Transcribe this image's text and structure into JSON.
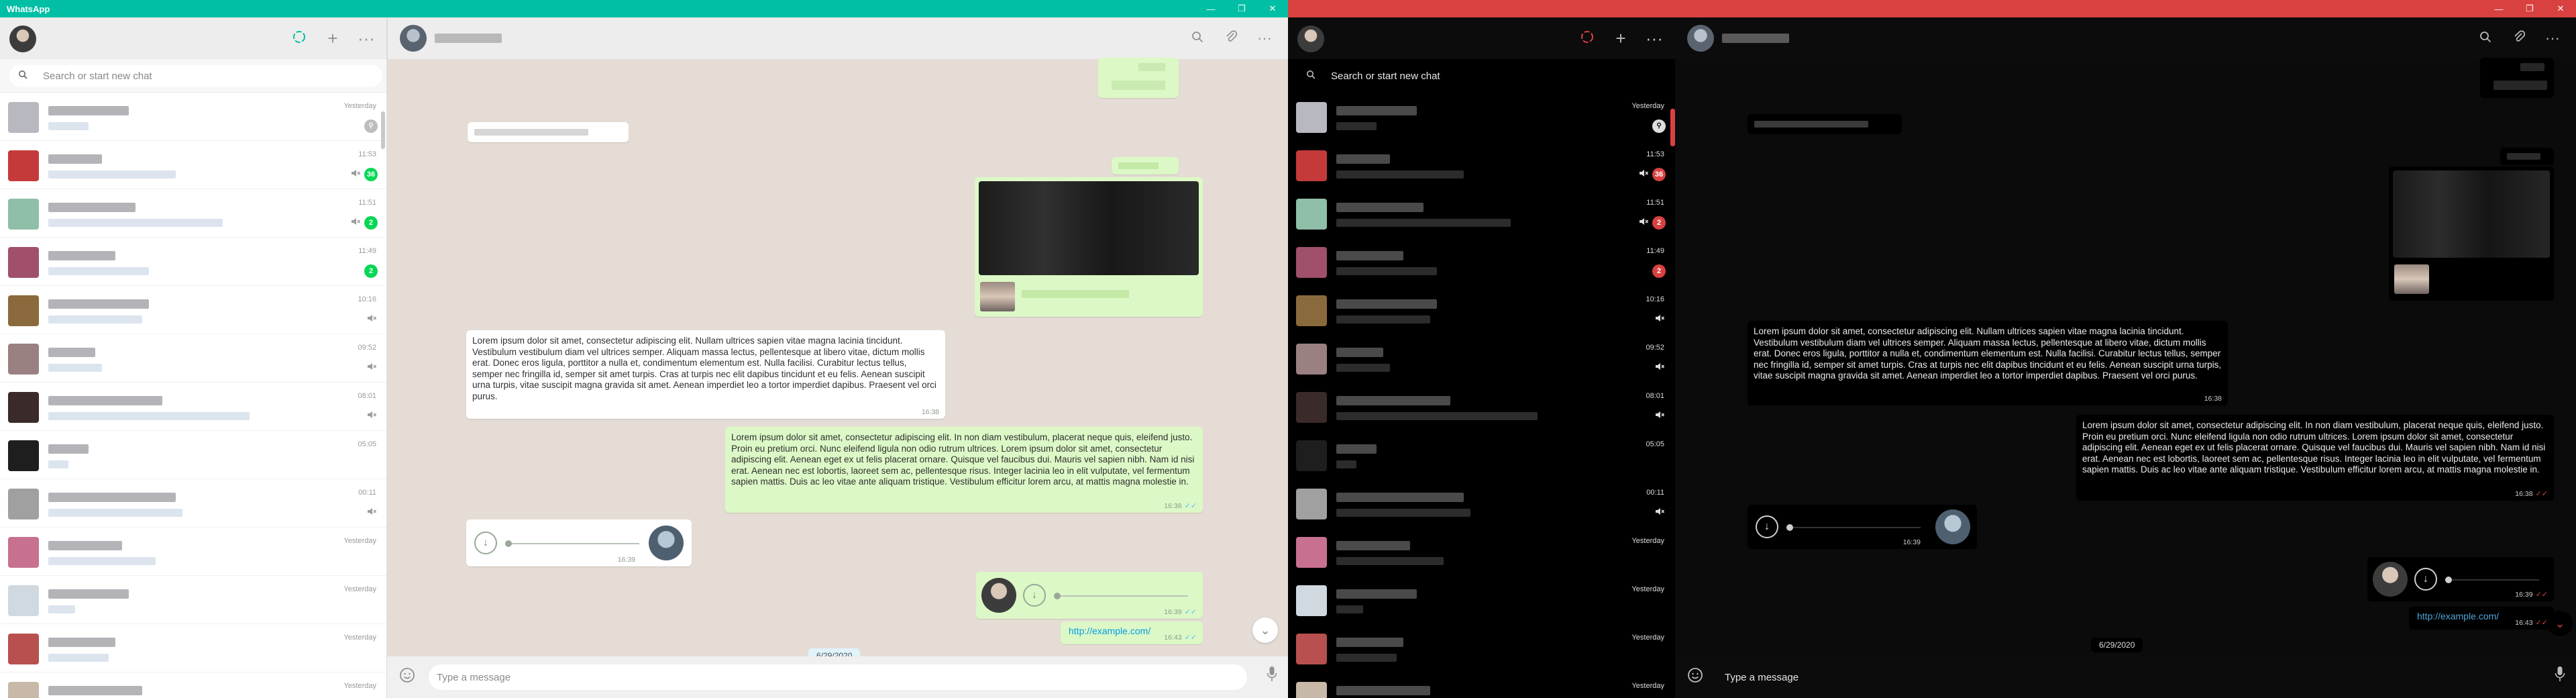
{
  "app": {
    "title": "WhatsApp"
  },
  "window_controls": {
    "minimize": "—",
    "maximize": "❐",
    "close": "✕"
  },
  "sidebar": {
    "header_icons": {
      "status": "status-icon",
      "new_chat": "+",
      "menu": "···"
    },
    "search": {
      "placeholder": "Search or start new chat"
    },
    "chats": [
      {
        "time": "Yesterday",
        "badge": "⚲",
        "badge_kind": "pin",
        "muted": false
      },
      {
        "time": "11:53",
        "badge": "36",
        "muted": true
      },
      {
        "time": "11:51",
        "badge": "2",
        "muted": true
      },
      {
        "time": "11:49",
        "badge": "2",
        "muted": false
      },
      {
        "time": "10:16",
        "badge": "",
        "muted": true
      },
      {
        "time": "09:52",
        "badge": "",
        "muted": true
      },
      {
        "time": "08:01",
        "badge": "",
        "muted": true
      },
      {
        "time": "05:05",
        "badge": "",
        "muted": false
      },
      {
        "time": "00:11",
        "badge": "",
        "muted": true
      },
      {
        "time": "Yesterday",
        "badge": "",
        "muted": false
      },
      {
        "time": "Yesterday",
        "badge": "",
        "muted": false
      },
      {
        "time": "Yesterday",
        "badge": "",
        "muted": false
      },
      {
        "time": "Yesterday",
        "badge": "",
        "muted": false
      }
    ]
  },
  "chat": {
    "header_icons": {
      "search": "search-icon",
      "attach": "attach-icon",
      "menu": "···"
    },
    "messages": {
      "incoming_text": "Lorem ipsum dolor sit amet, consectetur adipiscing elit. Nullam ultrices sapien vitae magna lacinia tincidunt. Vestibulum vestibulum diam vel ultrices semper. Aliquam massa lectus, pellentesque at libero vitae, dictum mollis erat. Donec eros ligula, porttitor a nulla et, condimentum elementum est. Nulla facilisi. Curabitur lectus tellus, semper nec fringilla id, semper sit amet turpis. Cras at turpis nec elit dapibus tincidunt et eu felis. Aenean suscipit urna turpis, vitae suscipit magna gravida sit amet. Aenean imperdiet leo a tortor imperdiet dapibus. Praesent vel orci purus.",
      "incoming_time": "16:38",
      "outgoing_text": "Lorem ipsum dolor sit amet, consectetur adipiscing elit. In non diam vestibulum, placerat neque quis, eleifend justo. Proin eu pretium orci. Nunc eleifend ligula non odio rutrum ultrices. Lorem ipsum dolor sit amet, consectetur adipiscing elit. Aenean eget ex ut felis placerat ornare. Quisque vel faucibus dui. Mauris vel sapien nibh. Nam id nisi erat. Aenean nec est lobortis, laoreet sem ac, pellentesque risus. Integer lacinia leo in elit vulputate, vel fermentum sapien mattis. Duis ac leo vitae ante aliquam tristique. Vestibulum efficitur lorem arcu, at mattis magna molestie in.",
      "outgoing_time": "16:38",
      "voice_in_time": "16:39",
      "voice_out_time": "16:39",
      "link_text": "http://example.com/",
      "link_time": "16:43",
      "date_divider": "6/29/2020"
    },
    "composer": {
      "placeholder": "Type a message"
    }
  }
}
